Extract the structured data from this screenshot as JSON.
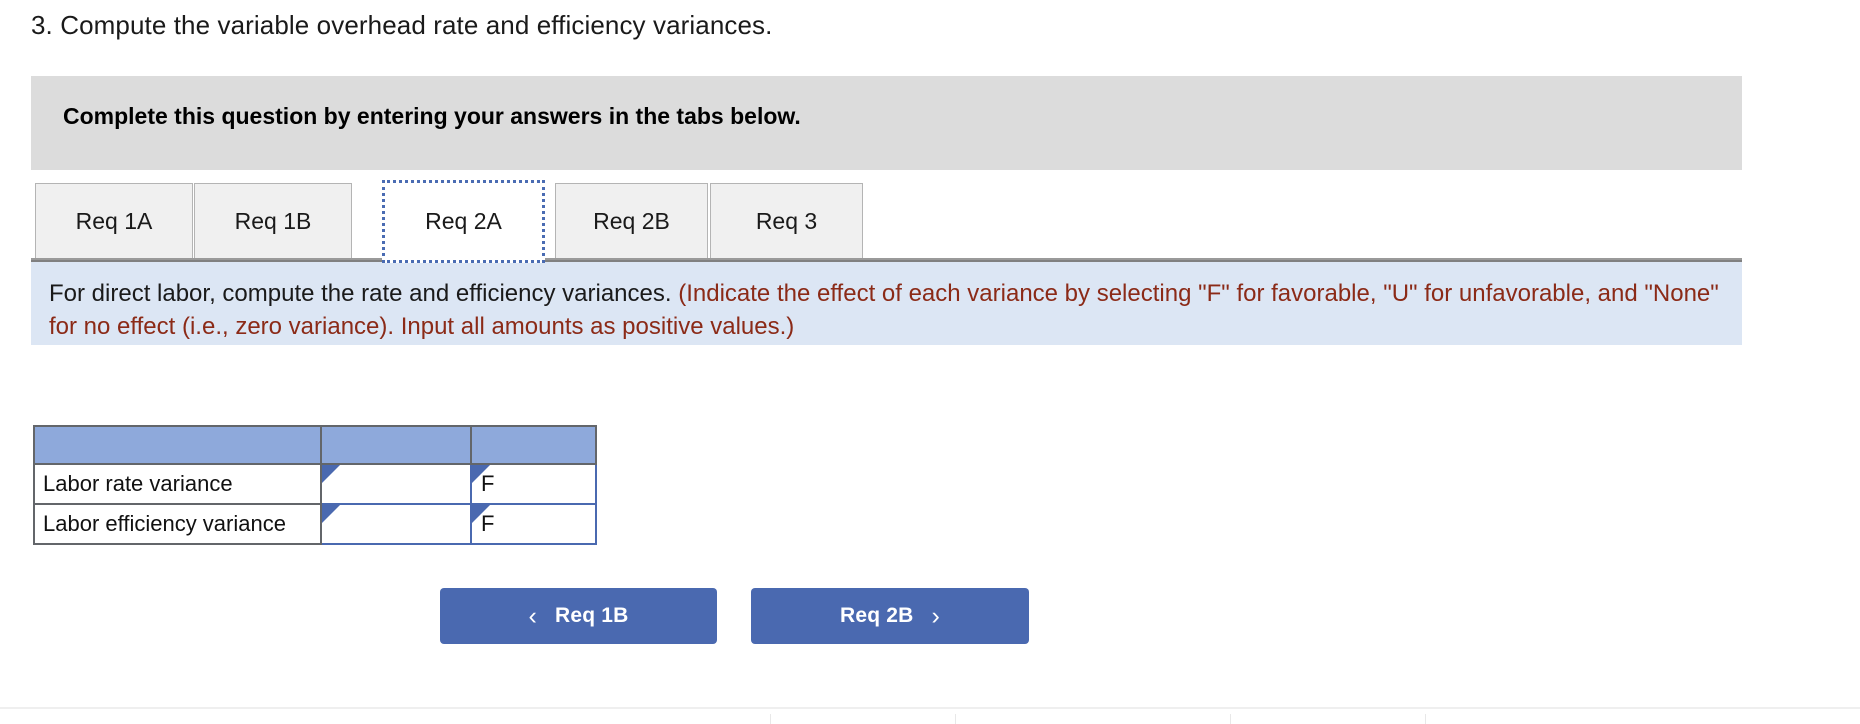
{
  "question": {
    "prompt": "3. Compute the variable overhead rate and efficiency variances."
  },
  "banner": {
    "text": "Complete this question by entering your answers in the tabs below."
  },
  "tabs": {
    "items": [
      {
        "id": "req-1a",
        "label": "Req 1A",
        "active": false
      },
      {
        "id": "req-1b",
        "label": "Req 1B",
        "active": false
      },
      {
        "id": "req-2a",
        "label": "Req 2A",
        "active": true
      },
      {
        "id": "req-2b",
        "label": "Req 2B",
        "active": false
      },
      {
        "id": "req-3",
        "label": "Req 3",
        "active": false
      }
    ]
  },
  "requirement": {
    "main": "For direct labor, compute the rate and efficiency variances. ",
    "note": "(Indicate the effect of each variance by selecting \"F\" for favorable, \"U\" for unfavorable, and \"None\" for no effect (i.e., zero variance). Input all amounts as positive values.)",
    "background_color": "#dce6f4",
    "note_color": "#8b2a17"
  },
  "answer_table": {
    "header_color": "#8ea9db",
    "headers": [
      "",
      "",
      ""
    ],
    "rows": [
      {
        "label": "Labor rate variance",
        "amount": "",
        "amount_placeholder": "",
        "effect": "F"
      },
      {
        "label": "Labor efficiency variance",
        "amount": "",
        "amount_placeholder": "",
        "effect": "F"
      }
    ]
  },
  "navigation": {
    "prev_label": "Req 1B",
    "prev_icon": "chevron-left-icon",
    "prev_glyph": "‹",
    "next_label": "Req 2B",
    "next_icon": "chevron-right-icon",
    "next_glyph": "›",
    "button_color": "#4a69b0"
  }
}
